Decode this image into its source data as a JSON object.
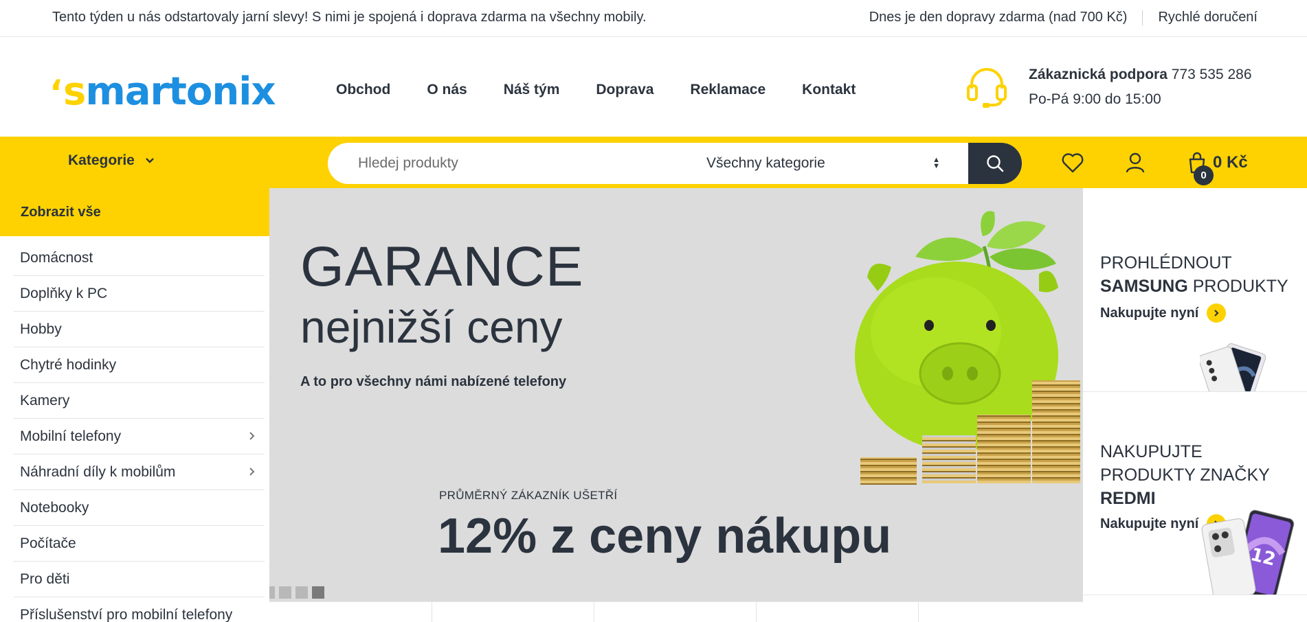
{
  "topbar": {
    "promo": "Tento týden u nás odstartovaly jarní slevy! S nimi je spojená i doprava zdarma na všechny mobily.",
    "free_shipping": "Dnes je den dopravy zdarma (nad 700 Kč)",
    "fast_delivery": "Rychlé doručení"
  },
  "logo": {
    "tick": "‘",
    "s": "s",
    "rest": "martonix"
  },
  "nav": [
    "Obchod",
    "O nás",
    "Náš tým",
    "Doprava",
    "Reklamace",
    "Kontakt"
  ],
  "support": {
    "label": "Zákaznická podpora",
    "phone": "773 535 286",
    "hours": "Po-Pá 9:00 do 15:00"
  },
  "toolbar": {
    "categories_label": "Kategorie",
    "search_placeholder": "Hledej produkty",
    "category_select": "Všechny kategorie",
    "cart_count": "0",
    "cart_total": "0 Kč"
  },
  "sidebar": {
    "show_all": "Zobrazit vše",
    "items": [
      {
        "label": "Domácnost",
        "has_children": false
      },
      {
        "label": "Doplňky k PC",
        "has_children": false
      },
      {
        "label": "Hobby",
        "has_children": false
      },
      {
        "label": "Chytré hodinky",
        "has_children": false
      },
      {
        "label": "Kamery",
        "has_children": false
      },
      {
        "label": "Mobilní telefony",
        "has_children": true
      },
      {
        "label": "Náhradní díly k mobilům",
        "has_children": true
      },
      {
        "label": "Notebooky",
        "has_children": false
      },
      {
        "label": "Počítače",
        "has_children": false
      },
      {
        "label": "Pro děti",
        "has_children": false
      },
      {
        "label": "Příslušenství pro mobilní telefony",
        "has_children": false
      }
    ]
  },
  "hero": {
    "title": "GARANCE",
    "subtitle": "nejnižší ceny",
    "tagline": "A to pro všechny námi nabízené telefony",
    "kicker": "PRŮMĚRNÝ ZÁKAZNÍK UŠETŘÍ",
    "headline": "12% z ceny nákupu",
    "slide_count": 4,
    "active_slide": 4
  },
  "promos": {
    "samsung": {
      "line1": "PROHLÉDNOUT",
      "brand": "SAMSUNG",
      "line2_rest": "PRODUKTY",
      "cta": "Nakupujte nyní"
    },
    "redmi": {
      "line1": "NAKUPUJTE",
      "line2": "PRODUKTY ZNAČKY",
      "brand": "REDMI",
      "cta": "Nakupujte nyní"
    }
  },
  "colors": {
    "accent": "#fdd200",
    "dark": "#2b333e",
    "logo_blue": "#1d8fe0",
    "hero_bg": "#dcdcdc"
  }
}
